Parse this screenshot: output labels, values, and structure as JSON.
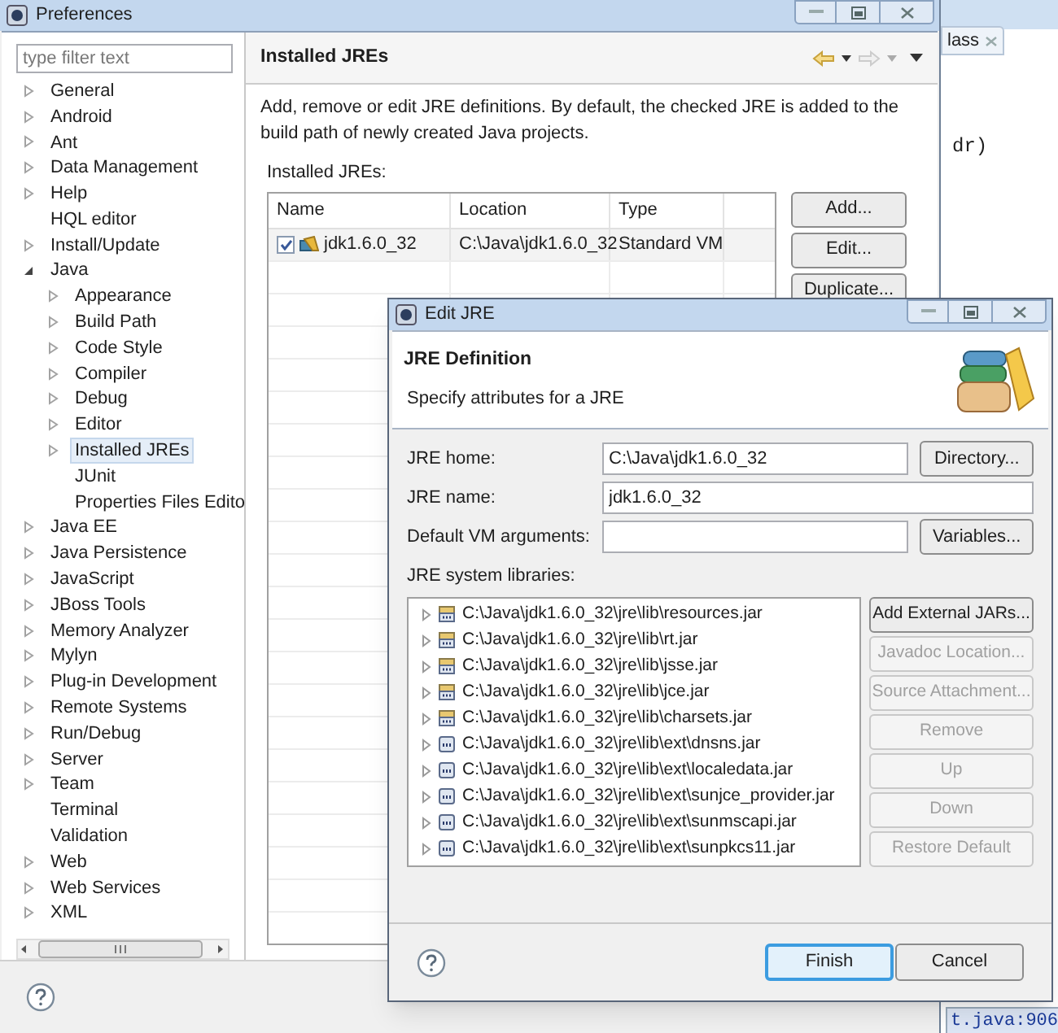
{
  "editor": {
    "tab": "lass",
    "code_lines": [
      "dr)"
    ],
    "status": "t.java:906"
  },
  "preferences": {
    "title": "Preferences",
    "filter": {
      "placeholder": "type filter text"
    },
    "tree": [
      {
        "label": "General",
        "expandable": true,
        "expanded": false,
        "selected": false
      },
      {
        "label": "Android",
        "expandable": true,
        "expanded": false,
        "selected": false
      },
      {
        "label": "Ant",
        "expandable": true,
        "expanded": false,
        "selected": false
      },
      {
        "label": "Data Management",
        "expandable": true,
        "expanded": false,
        "selected": false
      },
      {
        "label": "Help",
        "expandable": true,
        "expanded": false,
        "selected": false
      },
      {
        "label": "HQL editor",
        "expandable": false,
        "selected": false
      },
      {
        "label": "Install/Update",
        "expandable": true,
        "expanded": false,
        "selected": false
      },
      {
        "label": "Java",
        "expandable": true,
        "expanded": true,
        "selected": false,
        "children": [
          {
            "label": "Appearance",
            "expandable": true,
            "expanded": false,
            "selected": false
          },
          {
            "label": "Build Path",
            "expandable": true,
            "expanded": false,
            "selected": false
          },
          {
            "label": "Code Style",
            "expandable": true,
            "expanded": false,
            "selected": false
          },
          {
            "label": "Compiler",
            "expandable": true,
            "expanded": false,
            "selected": false
          },
          {
            "label": "Debug",
            "expandable": true,
            "expanded": false,
            "selected": false
          },
          {
            "label": "Editor",
            "expandable": true,
            "expanded": false,
            "selected": false
          },
          {
            "label": "Installed JREs",
            "expandable": true,
            "expanded": false,
            "selected": true
          },
          {
            "label": "JUnit",
            "expandable": false,
            "selected": false
          },
          {
            "label": "Properties Files Edito",
            "expandable": false,
            "selected": false
          }
        ]
      },
      {
        "label": "Java EE",
        "expandable": true,
        "expanded": false,
        "selected": false
      },
      {
        "label": "Java Persistence",
        "expandable": true,
        "expanded": false,
        "selected": false
      },
      {
        "label": "JavaScript",
        "expandable": true,
        "expanded": false,
        "selected": false
      },
      {
        "label": "JBoss Tools",
        "expandable": true,
        "expanded": false,
        "selected": false
      },
      {
        "label": "Memory Analyzer",
        "expandable": true,
        "expanded": false,
        "selected": false
      },
      {
        "label": "Mylyn",
        "expandable": true,
        "expanded": false,
        "selected": false
      },
      {
        "label": "Plug-in Development",
        "expandable": true,
        "expanded": false,
        "selected": false
      },
      {
        "label": "Remote Systems",
        "expandable": true,
        "expanded": false,
        "selected": false
      },
      {
        "label": "Run/Debug",
        "expandable": true,
        "expanded": false,
        "selected": false
      },
      {
        "label": "Server",
        "expandable": true,
        "expanded": false,
        "selected": false
      },
      {
        "label": "Team",
        "expandable": true,
        "expanded": false,
        "selected": false
      },
      {
        "label": "Terminal",
        "expandable": false,
        "selected": false
      },
      {
        "label": "Validation",
        "expandable": false,
        "selected": false
      },
      {
        "label": "Web",
        "expandable": true,
        "expanded": false,
        "selected": false
      },
      {
        "label": "Web Services",
        "expandable": true,
        "expanded": false,
        "selected": false
      },
      {
        "label": "XML",
        "expandable": true,
        "expanded": false,
        "selected": false
      }
    ],
    "page": {
      "title": "Installed JREs",
      "description": "Add, remove or edit JRE definitions. By default, the checked JRE is added to the build path of newly created Java projects.",
      "table_label": "Installed JREs:",
      "table": {
        "columns": [
          "Name",
          "Location",
          "Type"
        ],
        "rows": [
          {
            "checked": true,
            "name": "jdk1.6.0_32",
            "location": "C:\\Java\\jdk1.6.0_32",
            "type": "Standard VM"
          }
        ]
      },
      "buttons": [
        "Add...",
        "Edit...",
        "Duplicate..."
      ]
    }
  },
  "edit_jre": {
    "title": "Edit JRE",
    "heading": "JRE Definition",
    "subheading": "Specify attributes for a JRE",
    "fields": [
      {
        "label": "JRE home:",
        "value": "C:\\Java\\jdk1.6.0_32",
        "button": "Directory..."
      },
      {
        "label": "JRE name:",
        "value": "jdk1.6.0_32"
      },
      {
        "label": "Default VM arguments:",
        "button": "Variables..."
      }
    ],
    "libraries_label": "JRE system libraries:",
    "libraries": [
      {
        "path": "C:\\Java\\jdk1.6.0_32\\jre\\lib\\resources.jar",
        "kind": "lib"
      },
      {
        "path": "C:\\Java\\jdk1.6.0_32\\jre\\lib\\rt.jar",
        "kind": "lib"
      },
      {
        "path": "C:\\Java\\jdk1.6.0_32\\jre\\lib\\jsse.jar",
        "kind": "lib"
      },
      {
        "path": "C:\\Java\\jdk1.6.0_32\\jre\\lib\\jce.jar",
        "kind": "lib"
      },
      {
        "path": "C:\\Java\\jdk1.6.0_32\\jre\\lib\\charsets.jar",
        "kind": "lib"
      },
      {
        "path": "C:\\Java\\jdk1.6.0_32\\jre\\lib\\ext\\dnsns.jar",
        "kind": "ext"
      },
      {
        "path": "C:\\Java\\jdk1.6.0_32\\jre\\lib\\ext\\localedata.jar",
        "kind": "ext"
      },
      {
        "path": "C:\\Java\\jdk1.6.0_32\\jre\\lib\\ext\\sunjce_provider.jar",
        "kind": "ext"
      },
      {
        "path": "C:\\Java\\jdk1.6.0_32\\jre\\lib\\ext\\sunmscapi.jar",
        "kind": "ext"
      },
      {
        "path": "C:\\Java\\jdk1.6.0_32\\jre\\lib\\ext\\sunpkcs11.jar",
        "kind": "ext"
      }
    ],
    "library_buttons": [
      {
        "label": "Add External JARs...",
        "disabled": false
      },
      {
        "label": "Javadoc Location...",
        "disabled": true
      },
      {
        "label": "Source Attachment...",
        "disabled": true
      },
      {
        "label": "Remove",
        "disabled": true
      },
      {
        "label": "Up",
        "disabled": true
      },
      {
        "label": "Down",
        "disabled": true
      },
      {
        "label": "Restore Default",
        "disabled": true
      }
    ],
    "buttons": [
      {
        "label": "Finish",
        "default": true
      },
      {
        "label": "Cancel",
        "default": false
      }
    ]
  }
}
